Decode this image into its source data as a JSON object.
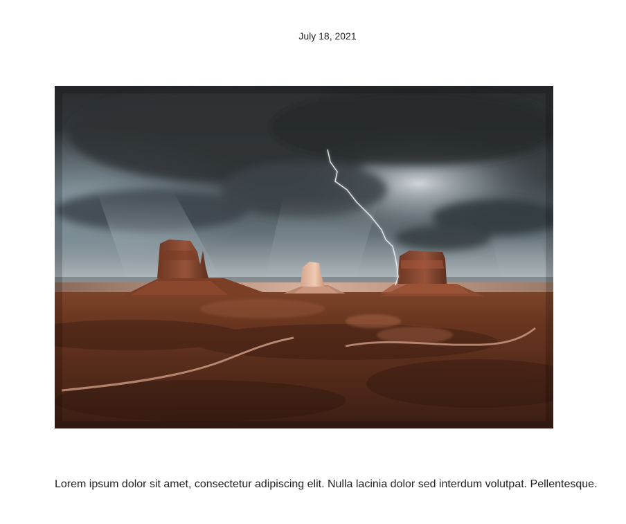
{
  "post": {
    "date": "July 18, 2021",
    "image": {
      "subject": "monument-valley-storm-photo",
      "palette": {
        "sky_dark": "#2a2d30",
        "sky_mid": "#4a5257",
        "sky_light": "#b7c1c8",
        "horizon_glow": "#d7b39c",
        "butte": "#8b4a2f",
        "butte_light": "#c77b59",
        "desert_dark": "#3d2219",
        "desert_mid": "#7b3f26",
        "road": "#b8866f",
        "lightning": "#e9eef4"
      }
    },
    "excerpt": "Lorem ipsum dolor sit amet, consectetur adipiscing elit. Nulla lacinia dolor sed interdum volutpat. Pellentesque."
  }
}
